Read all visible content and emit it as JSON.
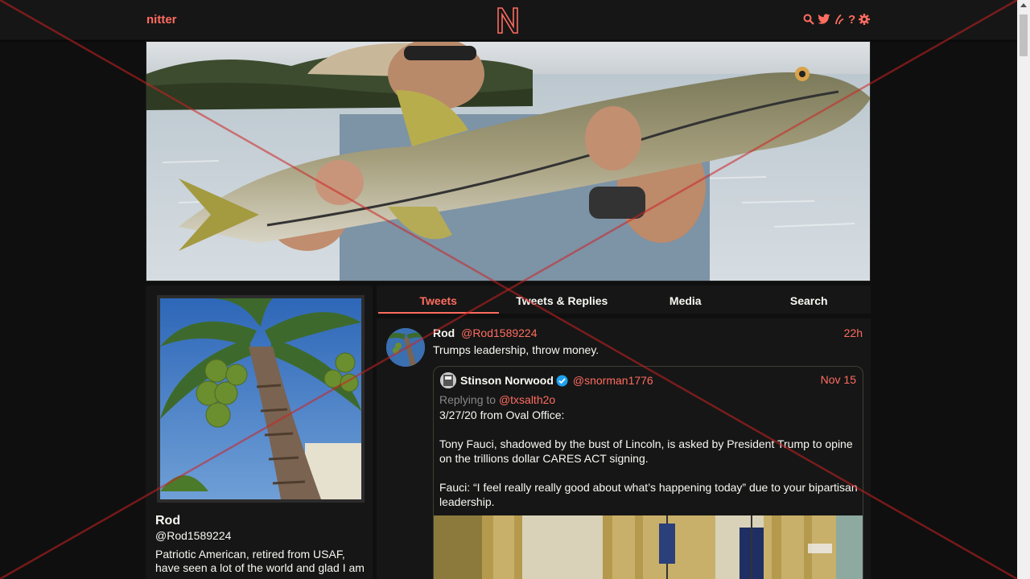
{
  "nav": {
    "brand": "nitter",
    "logo_letter": "N",
    "icons": [
      "search-icon",
      "twitter-icon",
      "rss-icon",
      "help-icon",
      "settings-icon"
    ],
    "help_glyph": "?"
  },
  "profile": {
    "fullname": "Rod",
    "username": "@Rod1589224",
    "bio": "Patriotic American, retired from USAF, have seen a lot of the world and glad I am"
  },
  "tabs": [
    {
      "label": "Tweets",
      "active": true
    },
    {
      "label": "Tweets & Replies",
      "active": false
    },
    {
      "label": "Media",
      "active": false
    },
    {
      "label": "Search",
      "active": false
    }
  ],
  "tweet": {
    "fullname": "Rod",
    "username": "@Rod1589224",
    "date": "22h",
    "text": "Trumps leadership, throw money.",
    "quote": {
      "fullname": "Stinson Norwood",
      "verified": true,
      "username": "@snorman1776",
      "date": "Nov 15",
      "replying_label": "Replying to",
      "replying_to": "@txsalth2o",
      "paragraphs": [
        "3/27/20 from Oval Office:",
        "Tony Fauci, shadowed by the bust of Lincoln, is asked by President Trump to opine on the trillions dollar CARES ACT signing.",
        "Fauci: “I feel really really good about what’s happening today” due to your bipartisan leadership."
      ]
    }
  },
  "colors": {
    "accent": "#ff6c60",
    "background": "#0f0f0f",
    "panel": "#161616",
    "text": "#f8f8f2",
    "verified": "#1da1f2"
  }
}
